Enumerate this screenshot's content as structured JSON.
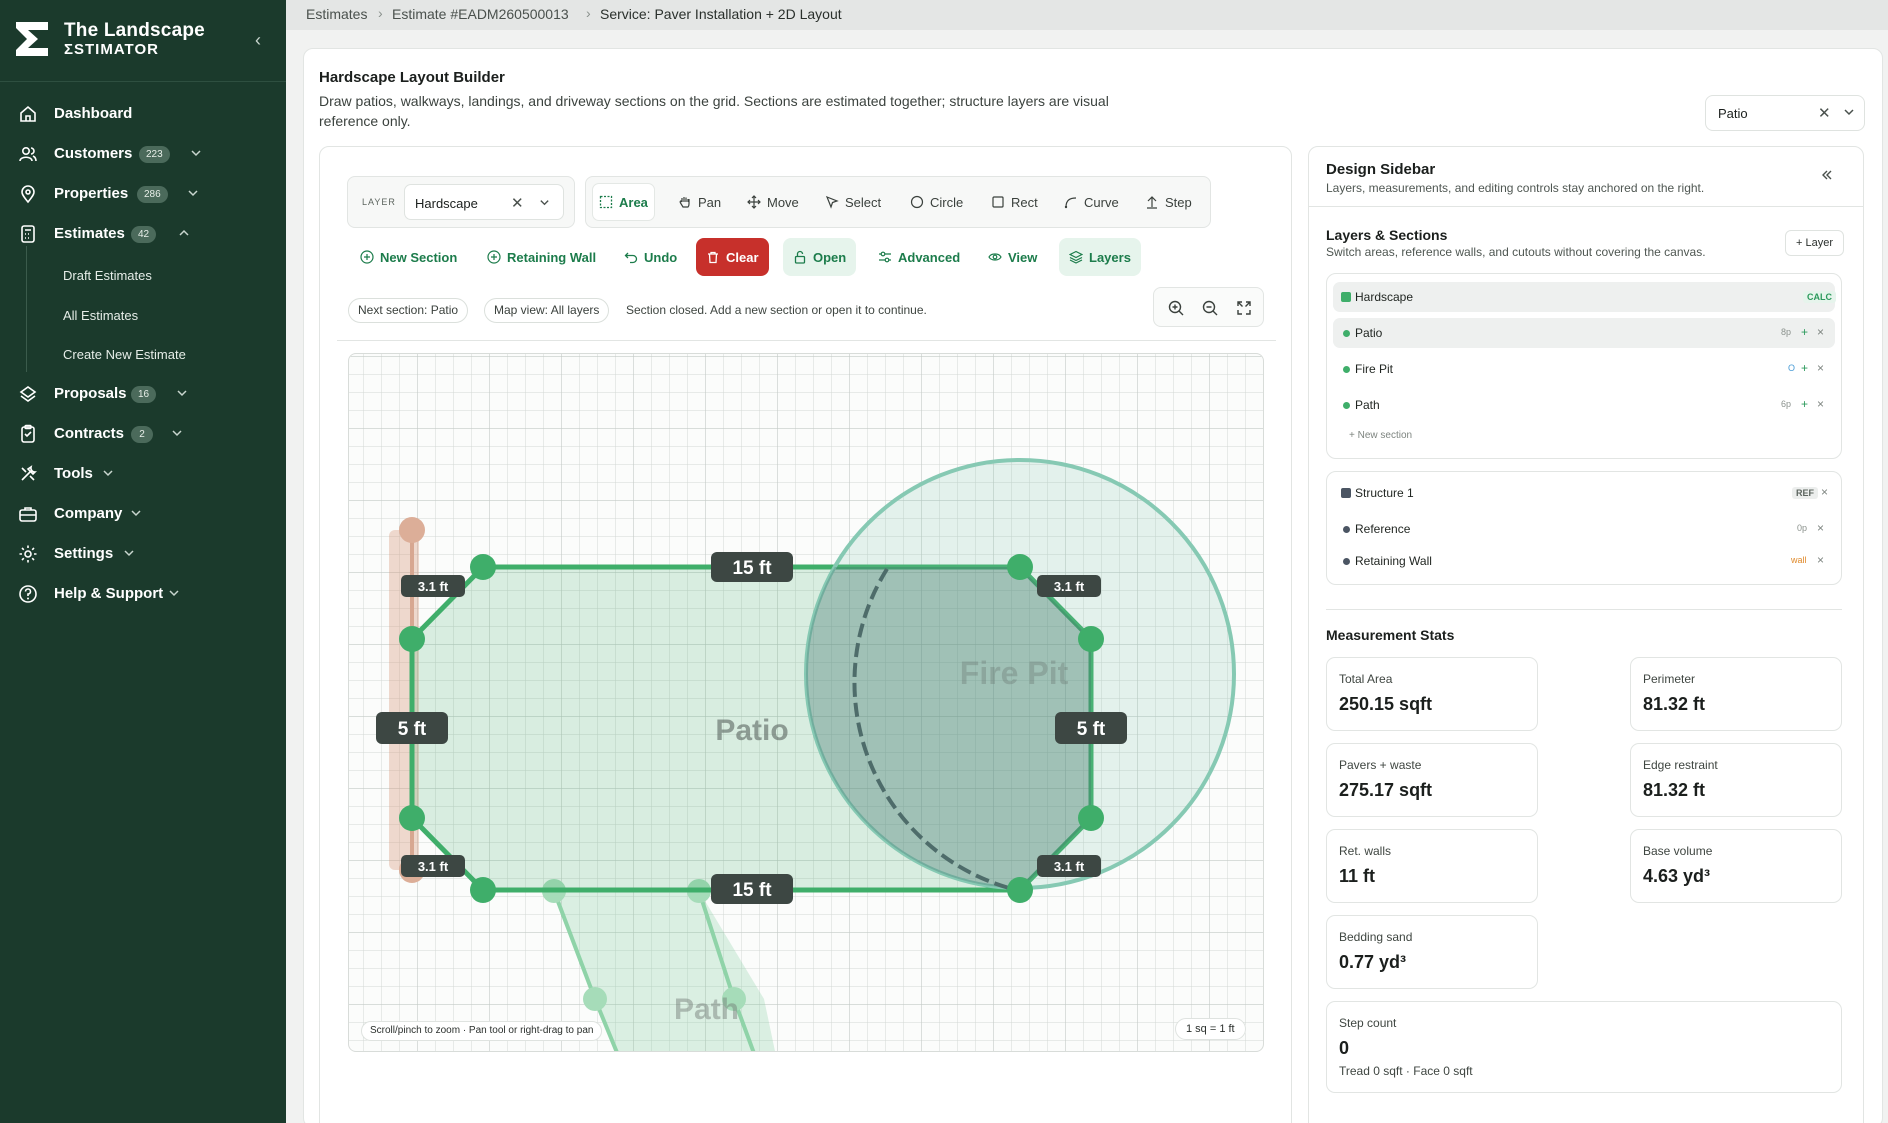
{
  "brand": {
    "line1": "The Landscape",
    "line2": "ΣSTIMATOR"
  },
  "nav": {
    "dashboard": "Dashboard",
    "customers": "Customers",
    "customers_count": "223",
    "properties": "Properties",
    "properties_count": "286",
    "estimates": "Estimates",
    "estimates_count": "42",
    "draft_estimates": "Draft Estimates",
    "all_estimates": "All Estimates",
    "create_estimate": "Create New Estimate",
    "proposals": "Proposals",
    "proposals_count": "16",
    "contracts": "Contracts",
    "contracts_count": "2",
    "tools": "Tools",
    "company": "Company",
    "settings": "Settings",
    "help": "Help & Support"
  },
  "breadcrumb": {
    "root": "Estimates",
    "estimate": "Estimate #EADM260500013",
    "current": "Service: Paver Installation + 2D Layout"
  },
  "builder": {
    "title": "Hardscape Layout Builder",
    "description": "Draw patios, walkways, landings, and driveway sections on the grid. Sections are estimated together; structure layers are visual reference only.",
    "section_select": "Patio"
  },
  "toolbar": {
    "layer_label": "LAYER",
    "layer_value": "Hardscape",
    "tools": {
      "area": "Area",
      "pan": "Pan",
      "move": "Move",
      "select": "Select",
      "circle": "Circle",
      "rect": "Rect",
      "curve": "Curve",
      "step": "Step"
    },
    "actions": {
      "new_section": "New Section",
      "retaining_wall": "Retaining Wall",
      "undo": "Undo",
      "clear": "Clear",
      "open": "Open",
      "advanced": "Advanced",
      "view": "View",
      "layers": "Layers"
    }
  },
  "status": {
    "next_section": "Next section: Patio",
    "map_view": "Map view: All layers",
    "message": "Section closed. Add a new section or open it to continue."
  },
  "canvas": {
    "labels": {
      "patio": "Patio",
      "fire_pit": "Fire Pit",
      "path": "Path"
    },
    "dims": {
      "top": "15 ft",
      "bottom": "15 ft",
      "left": "5 ft",
      "right": "5 ft",
      "corner": "3.1 ft"
    },
    "hint": "Scroll/pinch to zoom · Pan tool or right-drag to pan",
    "scale": "1 sq = 1 ft"
  },
  "sidebar_panel": {
    "title": "Design Sidebar",
    "subtitle": "Layers, measurements, and editing controls stay anchored on the right.",
    "layers_title": "Layers & Sections",
    "layers_subtitle": "Switch areas, reference walls, and cutouts without covering the canvas.",
    "add_layer": "+ Layer",
    "hardscape": {
      "name": "Hardscape",
      "tag": "CALC"
    },
    "sections": [
      {
        "name": "Patio",
        "meta": "8p"
      },
      {
        "name": "Fire Pit",
        "meta": "O"
      },
      {
        "name": "Path",
        "meta": "6p"
      }
    ],
    "new_section": "+ New section",
    "structure": {
      "name": "Structure 1",
      "tag": "REF"
    },
    "structure_items": [
      {
        "name": "Reference",
        "meta": "0p"
      },
      {
        "name": "Retaining Wall",
        "meta": "wall"
      }
    ]
  },
  "stats": {
    "title": "Measurement Stats",
    "total_area_label": "Total Area",
    "total_area": "250.15 sqft",
    "perimeter_label": "Perimeter",
    "perimeter": "81.32 ft",
    "pavers_label": "Pavers + waste",
    "pavers": "275.17 sqft",
    "edge_label": "Edge restraint",
    "edge": "81.32 ft",
    "walls_label": "Ret. walls",
    "walls": "11 ft",
    "base_label": "Base volume",
    "base": "4.63 yd³",
    "sand_label": "Bedding sand",
    "sand": "0.77 yd³",
    "step_label": "Step count",
    "step": "0",
    "step_detail": "Tread 0 sqft · Face 0 sqft"
  },
  "colors": {
    "sidebar_bg": "#1b3a2c",
    "accent": "#1c7c4b",
    "section_green": "#3fae6a",
    "danger": "#c7302b",
    "wall_orange": "#e08a2b"
  }
}
